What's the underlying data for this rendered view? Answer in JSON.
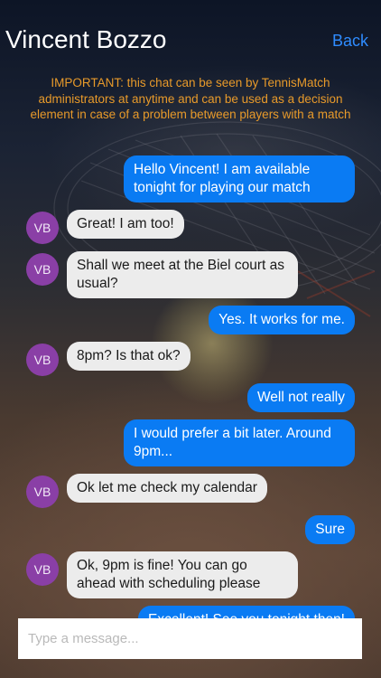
{
  "header": {
    "title": "Vincent Bozzo",
    "back_label": "Back"
  },
  "notice": "IMPORTANT: this chat can be seen by TennisMatch administrators at anytime and can be used as a decision element in case of a problem between players with a match",
  "contact_initials": "VB",
  "messages": [
    {
      "from": "me",
      "text": "Hello Vincent! I am available tonight for playing our match"
    },
    {
      "from": "them",
      "text": "Great! I am too!"
    },
    {
      "from": "them",
      "text": "Shall we meet at the Biel court as usual?"
    },
    {
      "from": "me",
      "text": "Yes. It works for me."
    },
    {
      "from": "them",
      "text": "8pm? Is that ok?"
    },
    {
      "from": "me",
      "text": "Well not really"
    },
    {
      "from": "me",
      "text": "I would prefer a bit later. Around 9pm..."
    },
    {
      "from": "them",
      "text": "Ok let me check my calendar"
    },
    {
      "from": "me",
      "text": "Sure"
    },
    {
      "from": "them",
      "text": "Ok, 9pm is fine! You can go ahead with scheduling please"
    },
    {
      "from": "me",
      "text": "Excellent! See you tonight then!"
    }
  ],
  "composer": {
    "placeholder": "Type a message..."
  }
}
